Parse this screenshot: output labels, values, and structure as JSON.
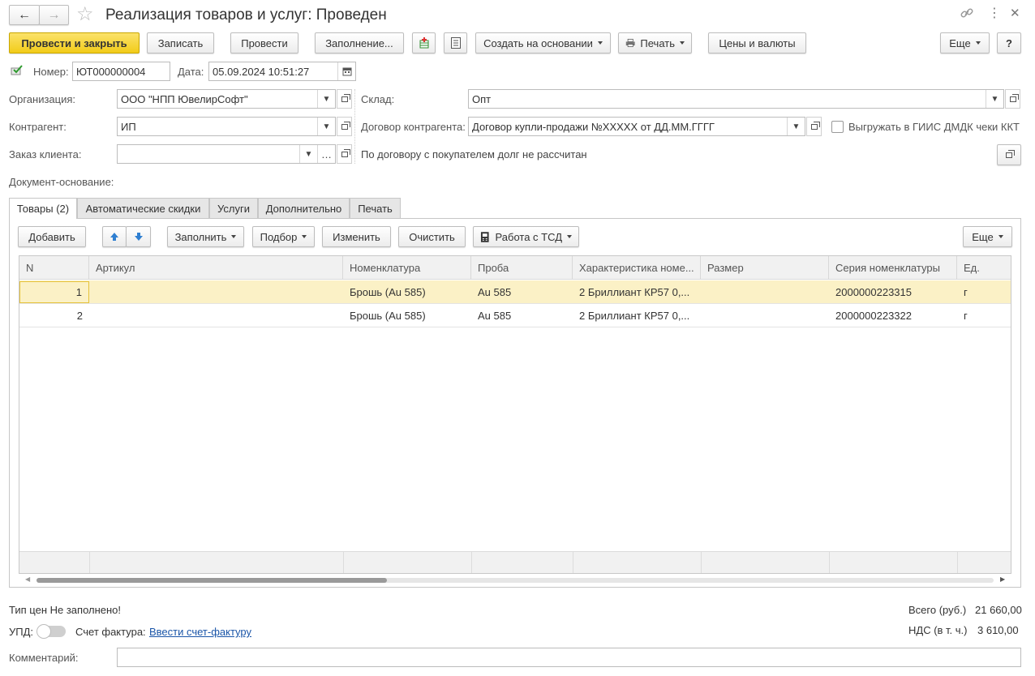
{
  "window": {
    "title": "Реализация товаров и услуг: Проведен",
    "nav_back_icon": "arrow-left-icon",
    "nav_forward_icon": "arrow-right-icon",
    "star_icon": "star-icon",
    "link_icon": "link-icon",
    "menu_icon": "more-vertical-icon",
    "close_icon": "close-icon"
  },
  "toolbar": {
    "post_close": "Провести и закрыть",
    "save": "Записать",
    "post": "Провести",
    "fill": "Заполнение...",
    "create_based": "Создать на основании",
    "print": "Печать",
    "prices": "Цены и валюты",
    "more": "Еще",
    "help": "?"
  },
  "header": {
    "number_label": "Номер:",
    "number_value": "ЮТ000000004",
    "date_label": "Дата:",
    "date_value": "05.09.2024 10:51:27"
  },
  "form": {
    "org_label": "Организация:",
    "org_value": "ООО \"НПП ЮвелирСофт\"",
    "contractor_label": "Контрагент:",
    "contractor_value": "ИП",
    "order_label": "Заказ клиента:",
    "order_value": "",
    "warehouse_label": "Склад:",
    "warehouse_value": "Опт",
    "contract_label": "Договор контрагента:",
    "contract_value": "Договор купли-продажи №XXXXX от ДД.ММ.ГГГГ",
    "giis_label": "Выгружать в ГИИС ДМДК чеки ККТ",
    "giis_checked": false,
    "debt_text": "По договору с покупателем долг не рассчитан",
    "base_doc_label": "Документ-основание:"
  },
  "tabs": [
    {
      "label": "Товары (2)",
      "active": true
    },
    {
      "label": "Автоматические скидки",
      "active": false
    },
    {
      "label": "Услуги",
      "active": false
    },
    {
      "label": "Дополнительно",
      "active": false
    },
    {
      "label": "Печать",
      "active": false
    }
  ],
  "table_toolbar": {
    "add": "Добавить",
    "fill": "Заполнить",
    "pick": "Подбор",
    "edit": "Изменить",
    "clear": "Очистить",
    "tsd": "Работа с ТСД",
    "more": "Еще"
  },
  "table": {
    "columns": [
      "N",
      "Артикул",
      "Номенклатура",
      "Проба",
      "Характеристика номе...",
      "Размер",
      "Серия номенклатуры",
      "Ед."
    ],
    "rows": [
      [
        "1",
        "",
        "Брошь (Au 585)",
        "Au 585",
        "2 Бриллиант КР57 0,...",
        "",
        "2000000223315",
        "г"
      ],
      [
        "2",
        "",
        "Брошь (Au 585)",
        "Au 585",
        "2 Бриллиант КР57 0,...",
        "",
        "2000000223322",
        "г"
      ]
    ],
    "selected_row": 0
  },
  "footer": {
    "price_type": "Тип цен Не заполнено!",
    "upd_label": "УПД:",
    "upd_on": false,
    "invoice_label": "Счет фактура:",
    "invoice_link": "Ввести счет-фактуру",
    "total_label": "Всего (руб.)",
    "total_value": "21 660,00",
    "vat_label": "НДС (в т. ч.)",
    "vat_value": "3 610,00",
    "comment_label": "Комментарий:",
    "comment_value": ""
  },
  "colors": {
    "primary_button": "#f2cc19",
    "selected_row": "#fbf1c6",
    "link": "#1a55a8"
  }
}
